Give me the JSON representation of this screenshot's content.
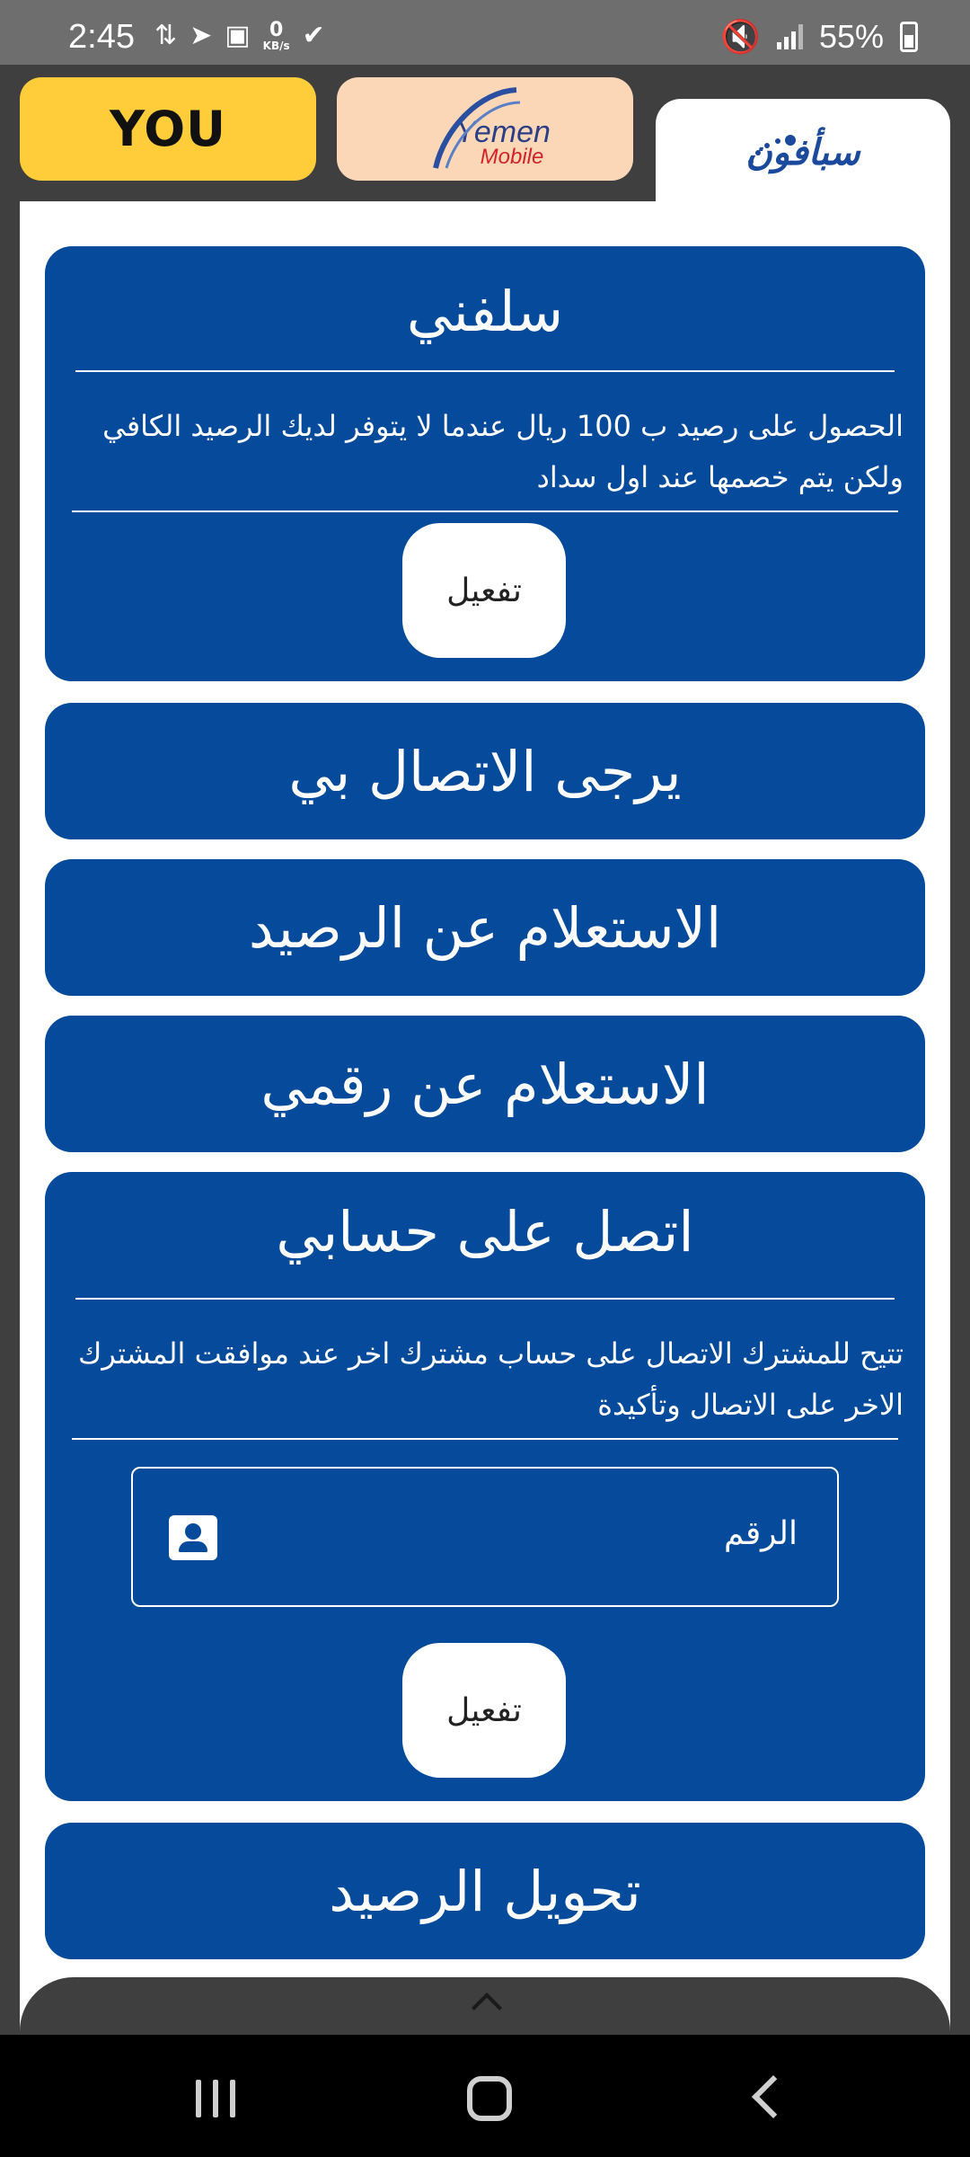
{
  "status_bar": {
    "time": "2:45",
    "data_speed_value": "0",
    "data_speed_unit": "KB/s",
    "battery": "55%",
    "icons_left": [
      "network-activity-icon",
      "telegram-icon",
      "gallery-icon",
      "data-speed-icon",
      "check-circle-icon"
    ],
    "icons_right": [
      "mute-icon",
      "signal-icon",
      "battery-charging-icon"
    ]
  },
  "tabs": {
    "you_label": "YOU",
    "yemen_mobile_line1": "Yemen",
    "yemen_mobile_line2": "Mobile",
    "sabafon_label": "سبأفون"
  },
  "cards": {
    "salafni": {
      "title": "سلفني",
      "description": "الحصول على رصيد ب 100 ريال عندما لا يتوفر لديك الرصيد الكافي ولكن يتم خصمها عند اول سداد",
      "button": "تفعيل"
    },
    "call_me": {
      "title": "يرجى الاتصال بي"
    },
    "balance_inquiry": {
      "title": "الاستعلام عن الرصيد"
    },
    "number_inquiry": {
      "title": "الاستعلام عن رقمي"
    },
    "call_on_account": {
      "title": "اتصل على حسابي",
      "description": "تتيح للمشترك الاتصال على حساب مشترك اخر عند موافقت المشترك الاخر على الاتصال وتأكيدة",
      "field_label": "الرقم",
      "button": "تفعيل"
    },
    "transfer_balance": {
      "title": "تحويل الرصيد"
    }
  },
  "colors": {
    "card_blue": "#054a9b",
    "you_yellow": "#ffcc3a",
    "yemen_peach": "#fbd7b8"
  }
}
